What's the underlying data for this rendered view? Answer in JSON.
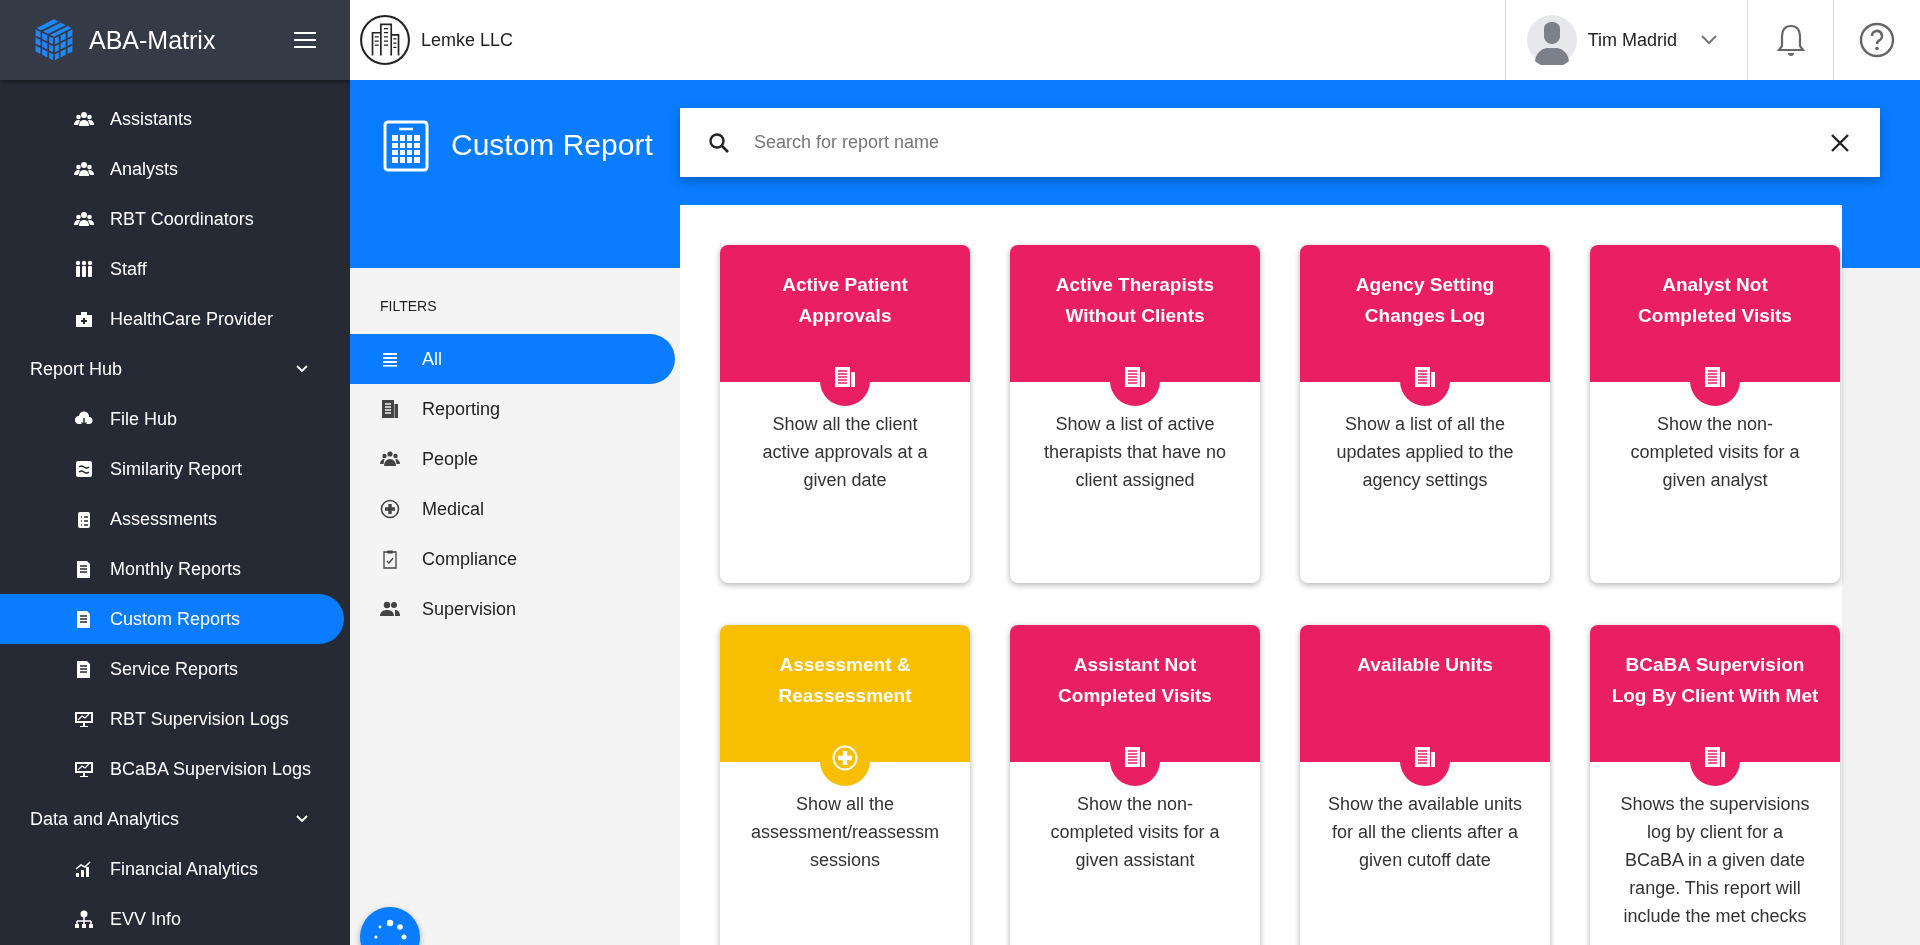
{
  "brand": {
    "name": "ABA-Matrix"
  },
  "company": {
    "name": "Lemke LLC"
  },
  "user": {
    "name": "Tim Madrid"
  },
  "sidebar": {
    "items": [
      {
        "kind": "item",
        "label": "Assistants",
        "selected": false
      },
      {
        "kind": "item",
        "label": "Analysts",
        "selected": false
      },
      {
        "kind": "item",
        "label": "RBT Coordinators",
        "selected": false
      },
      {
        "kind": "item",
        "label": "Staff",
        "selected": false
      },
      {
        "kind": "item",
        "label": "HealthCare Provider",
        "selected": false
      },
      {
        "kind": "section",
        "label": "Report Hub",
        "expanded": true,
        "children": [
          {
            "kind": "item",
            "label": "File Hub",
            "selected": false
          },
          {
            "kind": "item",
            "label": "Similarity Report",
            "selected": false
          },
          {
            "kind": "item",
            "label": "Assessments",
            "selected": false
          },
          {
            "kind": "item",
            "label": "Monthly Reports",
            "selected": false
          },
          {
            "kind": "item",
            "label": "Custom Reports",
            "selected": true
          },
          {
            "kind": "item",
            "label": "Service Reports",
            "selected": false
          },
          {
            "kind": "item",
            "label": "RBT Supervision Logs",
            "selected": false
          },
          {
            "kind": "item",
            "label": "BCaBA Supervision Logs",
            "selected": false
          }
        ]
      },
      {
        "kind": "section",
        "label": "Data and Analytics",
        "expanded": true,
        "children": [
          {
            "kind": "item",
            "label": "Financial Analytics",
            "selected": false
          },
          {
            "kind": "item",
            "label": "EVV Info",
            "selected": false
          }
        ]
      }
    ]
  },
  "page": {
    "title": "Custom Report"
  },
  "search": {
    "placeholder": "Search for report name"
  },
  "filters": {
    "heading": "FILTERS",
    "items": [
      {
        "label": "All",
        "selected": true
      },
      {
        "label": "Reporting",
        "selected": false
      },
      {
        "label": "People",
        "selected": false
      },
      {
        "label": "Medical",
        "selected": false
      },
      {
        "label": "Compliance",
        "selected": false
      },
      {
        "label": "Supervision",
        "selected": false
      }
    ]
  },
  "reports": [
    {
      "title": "Active Patient Approvals",
      "description": "Show all the client active approvals at a given date",
      "color": "#e91e63",
      "kind": "reporting"
    },
    {
      "title": "Active Therapists Without Clients",
      "description": "Show a list of active therapists that have no client assigned",
      "color": "#e91e63",
      "kind": "reporting"
    },
    {
      "title": "Agency Setting Changes Log",
      "description": "Show a list of all the updates applied to the agency settings",
      "color": "#e91e63",
      "kind": "reporting"
    },
    {
      "title": "Analyst Not Completed Visits",
      "description": "Show the non-completed visits for a given analyst",
      "color": "#e91e63",
      "kind": "reporting"
    },
    {
      "title": "Assessment & Reassessment",
      "description": "Show all the assessment/reassessm sessions",
      "color": "#f8bf00",
      "kind": "medical"
    },
    {
      "title": "Assistant Not Completed Visits",
      "description": "Show the non-completed visits for a given assistant",
      "color": "#e91e63",
      "kind": "reporting"
    },
    {
      "title": "Available Units",
      "description": "Show the available units for all the clients after a given cutoff date",
      "color": "#e91e63",
      "kind": "reporting"
    },
    {
      "title": "BCaBA Supervision Log By Client With Met",
      "description": "Shows the supervisions log by client for a BCaBA in a given date range. This report will include the met checks",
      "color": "#e91e63",
      "kind": "reporting"
    }
  ]
}
